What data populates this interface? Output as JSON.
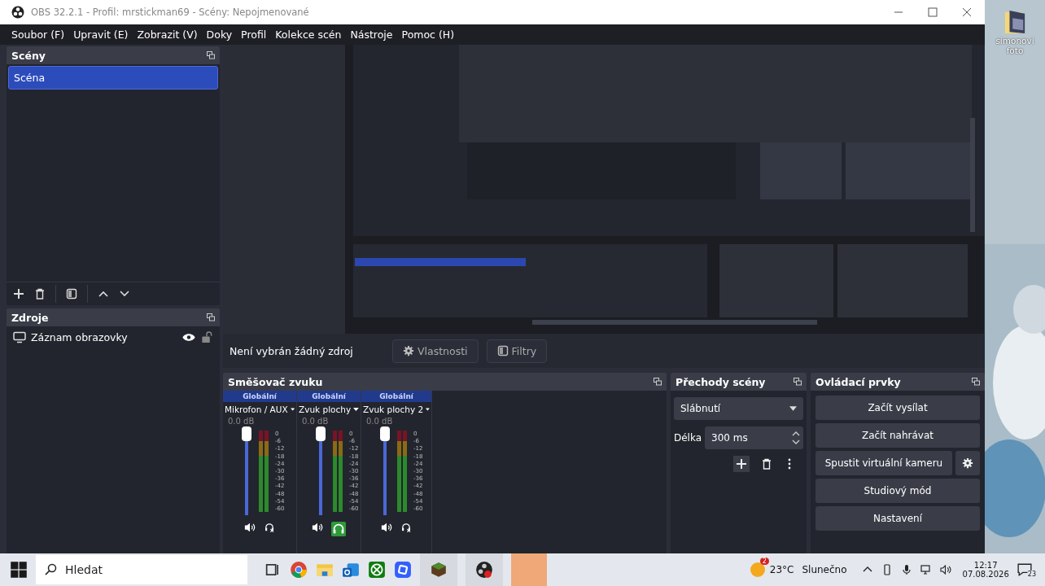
{
  "window": {
    "title": "OBS 32.2.1 - Profil: mrstickman69 - Scény: Nepojmenované"
  },
  "menu": [
    "Soubor (F)",
    "Upravit (E)",
    "Zobrazit (V)",
    "Doky",
    "Profil",
    "Kolekce scén",
    "Nástroje",
    "Pomoc (H)"
  ],
  "scenes": {
    "title": "Scény",
    "items": [
      {
        "label": "Scéna",
        "selected": true
      }
    ]
  },
  "sources": {
    "title": "Zdroje",
    "items": [
      {
        "label": "Záznam obrazovky",
        "visible": true,
        "locked": false
      }
    ]
  },
  "source_bar": {
    "status": "Není vybrán žádný zdroj",
    "buttons": [
      {
        "kind": "properties",
        "label": "Vlastnosti"
      },
      {
        "kind": "filters",
        "label": "Filtry"
      }
    ]
  },
  "mixer": {
    "title": "Směšovač zvuku",
    "channels": [
      {
        "header": "Globální",
        "name": "Mikrofon / AUX",
        "reading": "0.0 dB",
        "level": 1,
        "monitoring": false,
        "scale": [
          "0",
          "-6",
          "-12",
          "-18",
          "-24",
          "-30",
          "-36",
          "-42",
          "-48",
          "-54",
          "-60"
        ]
      },
      {
        "header": "Globální",
        "name": "Zvuk plochy",
        "reading": "0.0 dB",
        "level": 1,
        "monitoring": true,
        "scale": [
          "0",
          "-6",
          "-12",
          "-18",
          "-24",
          "-30",
          "-36",
          "-42",
          "-48",
          "-54",
          "-60"
        ]
      },
      {
        "header": "Globální",
        "name": "Zvuk plochy 2",
        "reading": "0.0 dB",
        "level": 1,
        "monitoring": false,
        "scale": [
          "0",
          "-6",
          "-12",
          "-18",
          "-24",
          "-30",
          "-36",
          "-42",
          "-48",
          "-54",
          "-60"
        ]
      }
    ]
  },
  "transitions": {
    "title": "Přechody scény",
    "selected": "Slábnutí",
    "duration_label": "Délka",
    "duration": "300 ms"
  },
  "controls": {
    "title": "Ovládací prvky",
    "buttons": [
      {
        "label": "Začít vysílat",
        "settings": false
      },
      {
        "label": "Začít nahrávat",
        "settings": false
      },
      {
        "label": "Spustit virtuální kameru",
        "settings": true
      },
      {
        "label": "Studiový mód",
        "settings": false
      },
      {
        "label": "Nastavení",
        "settings": false
      }
    ]
  },
  "desktop": {
    "icon_label": "simonovi foto"
  },
  "taskbar": {
    "search_placeholder": "Hledat",
    "weather": {
      "badge": "2",
      "temperature": "23°C",
      "condition": "Slunečno"
    },
    "time": "12:17",
    "date": "07.08.2026",
    "notifications": "23"
  }
}
